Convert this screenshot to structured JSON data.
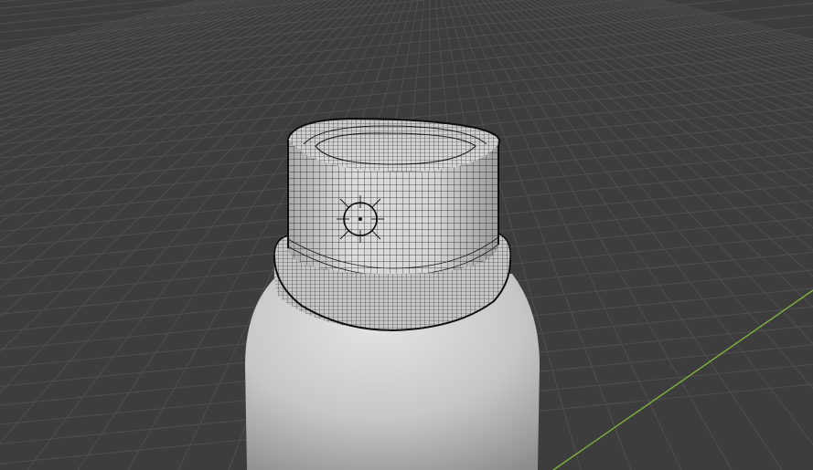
{
  "viewport": {
    "background_color": "#3d3d3d",
    "grid_color": "#4f4f4f",
    "x_axis_color": "#7fb03f",
    "cursor_icon": "3d-cursor-icon"
  },
  "scene": {
    "bottle_body_color": "#c4c4c4",
    "cap_color": "#d6d6d6",
    "wire_color": "#141414"
  }
}
